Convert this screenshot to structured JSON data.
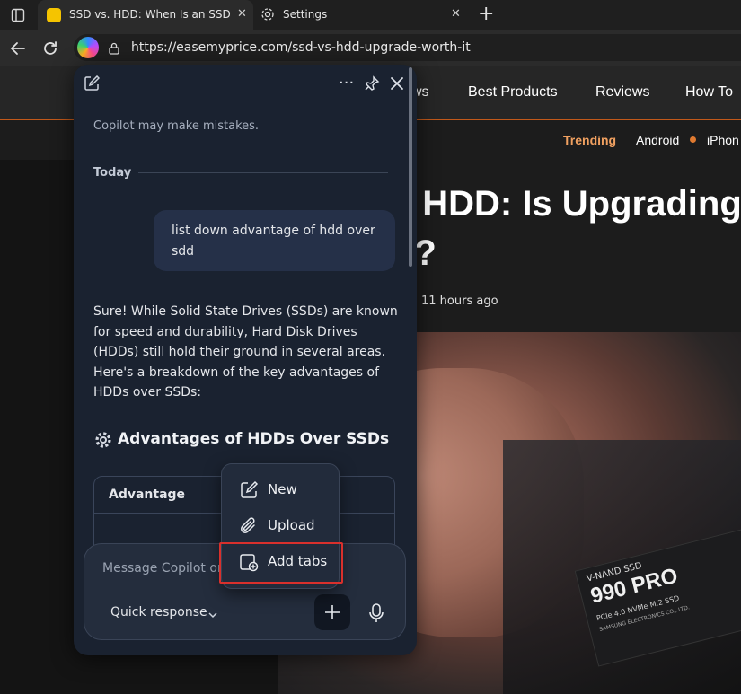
{
  "browser": {
    "tabs": [
      {
        "title": "SSD vs. HDD: When Is an SSD Upg",
        "active": true,
        "close": "✕"
      },
      {
        "title": "Settings",
        "active": false,
        "close": "✕"
      }
    ],
    "new_tab": "+",
    "url": "https://easemyprice.com/ssd-vs-hdd-upgrade-worth-it"
  },
  "site": {
    "nav": [
      "ws",
      "Best Products",
      "Reviews",
      "How To"
    ],
    "trending_label": "Trending",
    "trending_items": [
      "Android",
      "iPhon"
    ],
    "headline_line1": ". HDD: Is Upgrading",
    "headline_line2": ":?",
    "time_ago": "11 hours ago",
    "hero_text": {
      "brand": "V-NAND SSD",
      "model": "990 PRO",
      "spec": "PCIe 4.0 NVMe M.2 SSD",
      "maker": "SAMSUNG ELECTRONICS CO., LTD."
    }
  },
  "copilot": {
    "disclaimer": "Copilot may make mistakes.",
    "date_divider": "Today",
    "user_message_line1": "list down advantage of hdd over",
    "user_message_line2": "sdd",
    "reply_lines": [
      "Sure! While Solid State Drives (SSDs) are known",
      "for speed and durability, Hard Disk Drives",
      "(HDDs) still hold their ground in several areas.",
      "Here's a breakdown of the key advantages of",
      "HDDs over SSDs:"
    ],
    "section_heading": "Advantages of HDDs Over SSDs",
    "table_header": "Advantage",
    "composer_placeholder": "Message Copilot or",
    "quick_response": "Quick response",
    "menu": [
      {
        "label": "New",
        "icon": "new-chat-icon"
      },
      {
        "label": "Upload",
        "icon": "paperclip-icon"
      },
      {
        "label": "Add tabs",
        "icon": "add-tabs-icon"
      }
    ]
  },
  "colors": {
    "accent_orange": "#c2591a",
    "trending_orange": "#f0a060",
    "highlight_red": "#d9302c",
    "panel_bg": "#1a2230"
  }
}
